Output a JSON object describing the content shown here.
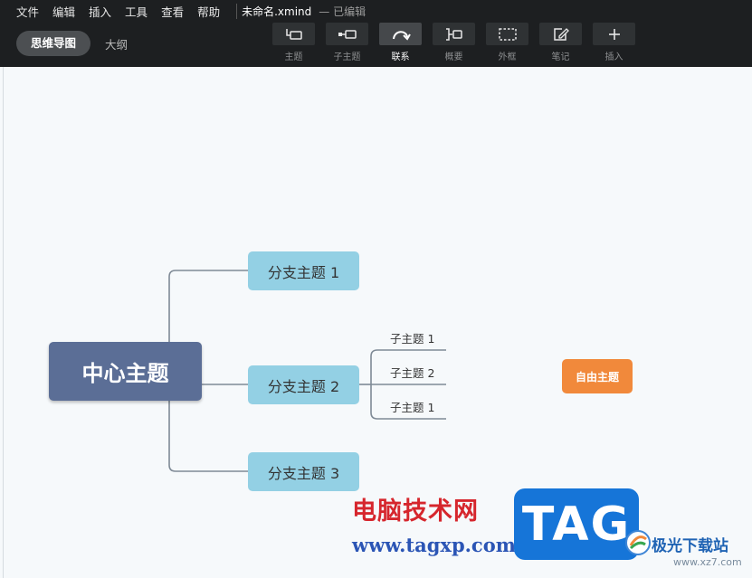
{
  "menu": {
    "items": [
      "文件",
      "编辑",
      "插入",
      "工具",
      "查看",
      "帮助"
    ],
    "file_title": "未命名.xmind",
    "status": "— 已编辑"
  },
  "views": {
    "active": "思维导图",
    "other": "大纲"
  },
  "toolbar": [
    {
      "label": "主题",
      "icon": "topic-icon"
    },
    {
      "label": "子主题",
      "icon": "subtopic-icon"
    },
    {
      "label": "联系",
      "icon": "relationship-icon",
      "active": true
    },
    {
      "label": "概要",
      "icon": "summary-icon"
    },
    {
      "label": "外框",
      "icon": "boundary-icon"
    },
    {
      "label": "笔记",
      "icon": "note-icon"
    },
    {
      "label": "插入",
      "icon": "plus-icon"
    }
  ],
  "mindmap": {
    "central": "中心主题",
    "branches": [
      "分支主题 1",
      "分支主题 2",
      "分支主题 3"
    ],
    "subtopics": [
      "子主题 1",
      "子主题 2",
      "子主题 1"
    ],
    "floating": "自由主题"
  },
  "watermark": {
    "brand": "电脑技术网",
    "url": "www.tagxp.com",
    "tag": "TAG",
    "site": "极光下载站",
    "site_url": "www.xz7.com"
  },
  "colors": {
    "toolbar_bg": "#1d1f21",
    "central": "#5b6e96",
    "branch": "#93d0e4",
    "floating": "#f1893b",
    "connector": "#7f8a96"
  }
}
